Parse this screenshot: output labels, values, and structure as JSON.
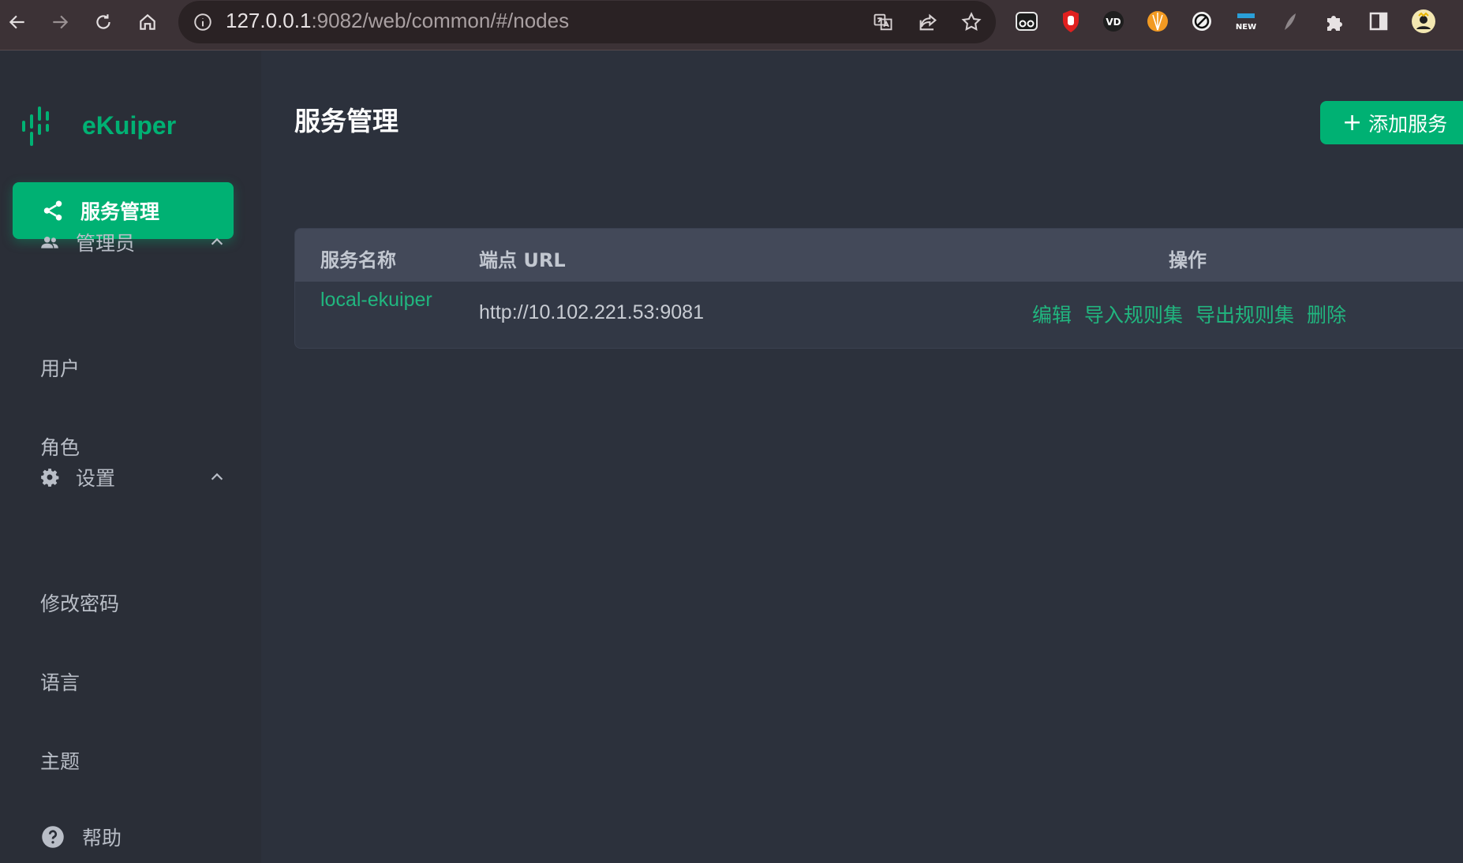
{
  "browser": {
    "url_host": "127.0.0.1",
    "url_rest": ":9082/web/common/#/nodes",
    "nav_icons": [
      "back-arrow-icon",
      "forward-arrow-icon",
      "reload-icon",
      "home-icon"
    ],
    "omnibox_icons": [
      "translate-icon",
      "share-icon",
      "star-icon"
    ],
    "extension_icons": [
      "glasses-extension-icon",
      "stop-hand-extension-icon",
      "vd-extension-icon",
      "shell-extension-icon",
      "block-extension-icon",
      "new-badge-extension-icon",
      "feather-extension-icon",
      "puzzle-icon",
      "side-panel-icon",
      "profile-avatar-icon"
    ]
  },
  "sidebar": {
    "brand": "eKuiper",
    "active_item": "服务管理",
    "groups": [
      {
        "label": "管理员",
        "items": [
          "用户",
          "角色"
        ]
      },
      {
        "label": "设置",
        "items": [
          "修改密码",
          "语言",
          "主题"
        ]
      }
    ],
    "help": "帮助"
  },
  "main": {
    "title": "服务管理",
    "add_button": "添加服务",
    "add_button_plus": "+",
    "table": {
      "headers": {
        "name": "服务名称",
        "endpoint": "端点 URL",
        "actions": "操作"
      },
      "rows": [
        {
          "name": "local-ekuiper",
          "endpoint": "http://10.102.221.53:9081",
          "actions": [
            "编辑",
            "导入规则集",
            "导出规则集",
            "删除"
          ]
        }
      ]
    }
  },
  "colors": {
    "accent": "#00b173",
    "background": "#2c313c",
    "sidebar": "#2a2e37"
  }
}
